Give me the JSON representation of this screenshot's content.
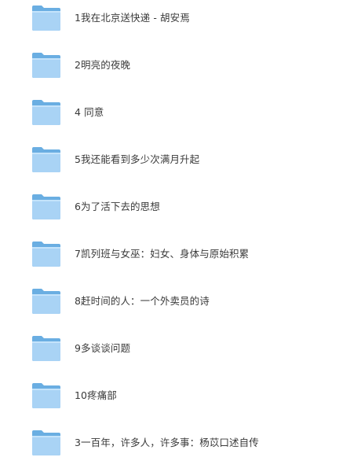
{
  "folders": [
    {
      "name": "1我在北京送快递 - 胡安焉",
      "icon": "folder-icon"
    },
    {
      "name": "2明亮的夜晚",
      "icon": "folder-icon"
    },
    {
      "name": "4 同意",
      "icon": "folder-icon"
    },
    {
      "name": "5我还能看到多少次满月升起",
      "icon": "folder-icon"
    },
    {
      "name": "6为了活下去的思想",
      "icon": "folder-icon"
    },
    {
      "name": "7凯列班与女巫：妇女、身体与原始积累",
      "icon": "folder-icon"
    },
    {
      "name": "8赶时间的人：一个外卖员的诗",
      "icon": "folder-icon"
    },
    {
      "name": "9多谈谈问题",
      "icon": "folder-icon"
    },
    {
      "name": "10疼痛部",
      "icon": "folder-icon"
    },
    {
      "name": "3一百年，许多人，许多事：杨苡口述自传",
      "icon": "folder-icon"
    }
  ],
  "colors": {
    "folder_back": "#6aaee2",
    "folder_front": "#a9d3f5",
    "folder_front_top": "#bfe0fa",
    "text": "#3a3a3a"
  }
}
